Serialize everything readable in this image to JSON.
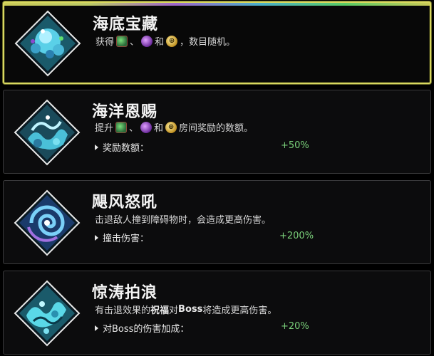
{
  "cards": [
    {
      "title": "海底宝藏",
      "desc_prefix": "获得",
      "desc_sep1": "、",
      "desc_and": "和",
      "desc_suffix": "，数目随机。",
      "icon": "treasure-orb-icon",
      "selected": true
    },
    {
      "title": "海洋恩赐",
      "desc_prefix": "提升",
      "desc_sep1": "、",
      "desc_and": "和",
      "desc_suffix": "房间奖励的数额。",
      "stat_label": "奖励数额：",
      "stat_value": "+50%",
      "icon": "ocean-wave-icon",
      "selected": false
    },
    {
      "title": "飓风怒吼",
      "desc": "击退敌人撞到障碍物时，会造成更高伤害。",
      "stat_label": "撞击伤害：",
      "stat_value": "+200%",
      "icon": "whirlpool-icon",
      "selected": false
    },
    {
      "title": "惊涛拍浪",
      "desc_prefix": "有击退效果的",
      "desc_hl1": "祝福",
      "desc_mid": "对",
      "desc_hl2": "Boss",
      "desc_suffix": "将造成更高伤害。",
      "stat_label": "对Boss的伤害加成：",
      "stat_value": "+20%",
      "icon": "crashing-wave-icon",
      "selected": false
    }
  ],
  "colors": {
    "selected_border": "#d8d860",
    "stat_value": "#7ad07a",
    "card_border": "#3a3a3c"
  }
}
